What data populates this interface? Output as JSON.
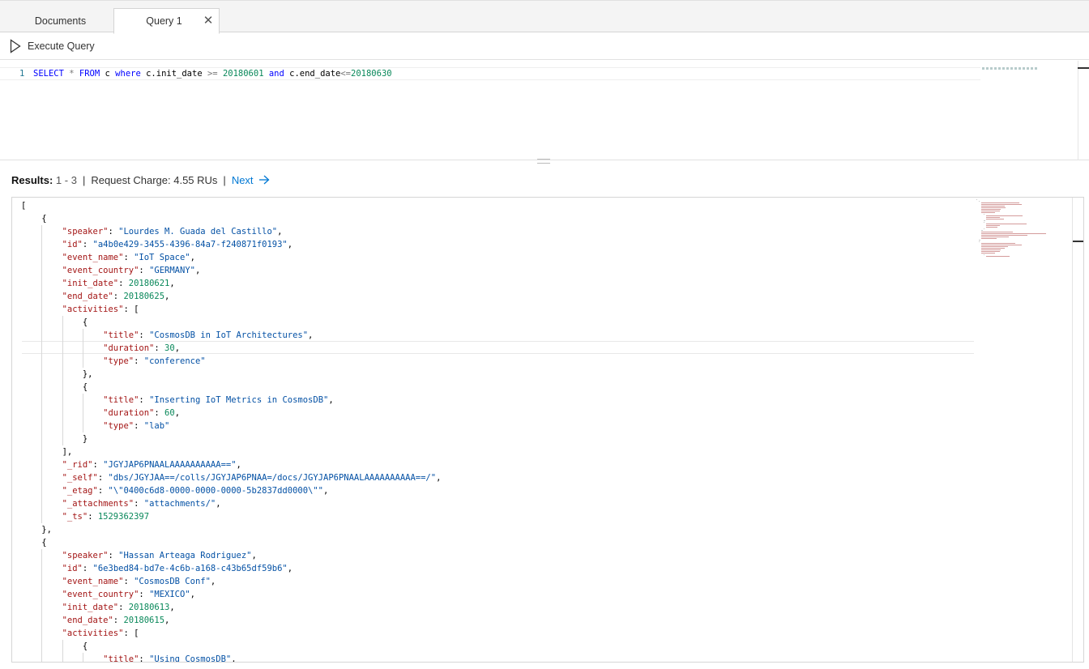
{
  "tabs": [
    {
      "label": "Documents"
    },
    {
      "label": "Query 1"
    }
  ],
  "toolbar": {
    "execute_label": "Execute Query"
  },
  "editor": {
    "line_number": "1",
    "tokens": [
      {
        "t": "SELECT",
        "c": "kw"
      },
      {
        "t": " * ",
        "c": "op"
      },
      {
        "t": "FROM",
        "c": "kw"
      },
      {
        "t": " c ",
        "c": "id"
      },
      {
        "t": "where",
        "c": "kw"
      },
      {
        "t": " c.init_date ",
        "c": "id"
      },
      {
        "t": ">=",
        "c": "op"
      },
      {
        "t": " 20180601 ",
        "c": "num"
      },
      {
        "t": "and",
        "c": "kw"
      },
      {
        "t": " c.end_date",
        "c": "id"
      },
      {
        "t": "<=",
        "c": "op"
      },
      {
        "t": "20180630",
        "c": "num"
      }
    ]
  },
  "results": {
    "label": "Results:",
    "range": "1 - 3",
    "charge": "Request Charge: 4.55 RUs",
    "next_label": "Next"
  },
  "json_lines": [
    [
      0,
      [
        [
          "[",
          "p"
        ]
      ]
    ],
    [
      1,
      [
        [
          "{",
          "p"
        ]
      ]
    ],
    [
      2,
      [
        [
          "\"speaker\"",
          "k"
        ],
        [
          ": ",
          "p"
        ],
        [
          "\"Lourdes M. Guada del Castillo\"",
          "s"
        ],
        [
          ",",
          "p"
        ]
      ]
    ],
    [
      2,
      [
        [
          "\"id\"",
          "k"
        ],
        [
          ": ",
          "p"
        ],
        [
          "\"a4b0e429-3455-4396-84a7-f240871f0193\"",
          "s"
        ],
        [
          ",",
          "p"
        ]
      ]
    ],
    [
      2,
      [
        [
          "\"event_name\"",
          "k"
        ],
        [
          ": ",
          "p"
        ],
        [
          "\"IoT Space\"",
          "s"
        ],
        [
          ",",
          "p"
        ]
      ]
    ],
    [
      2,
      [
        [
          "\"event_country\"",
          "k"
        ],
        [
          ": ",
          "p"
        ],
        [
          "\"GERMANY\"",
          "s"
        ],
        [
          ",",
          "p"
        ]
      ]
    ],
    [
      2,
      [
        [
          "\"init_date\"",
          "k"
        ],
        [
          ": ",
          "p"
        ],
        [
          "20180621",
          "n"
        ],
        [
          ",",
          "p"
        ]
      ]
    ],
    [
      2,
      [
        [
          "\"end_date\"",
          "k"
        ],
        [
          ": ",
          "p"
        ],
        [
          "20180625",
          "n"
        ],
        [
          ",",
          "p"
        ]
      ]
    ],
    [
      2,
      [
        [
          "\"activities\"",
          "k"
        ],
        [
          ": [",
          "p"
        ]
      ]
    ],
    [
      3,
      [
        [
          "{",
          "p"
        ]
      ]
    ],
    [
      4,
      [
        [
          "\"title\"",
          "k"
        ],
        [
          ": ",
          "p"
        ],
        [
          "\"CosmosDB in IoT Architectures\"",
          "s"
        ],
        [
          ",",
          "p"
        ]
      ]
    ],
    [
      4,
      [
        [
          "\"duration\"",
          "k"
        ],
        [
          ": ",
          "p"
        ],
        [
          "30",
          "n"
        ],
        [
          ",",
          "p"
        ]
      ]
    ],
    [
      4,
      [
        [
          "\"type\"",
          "k"
        ],
        [
          ": ",
          "p"
        ],
        [
          "\"conference\"",
          "s"
        ]
      ]
    ],
    [
      3,
      [
        [
          "},",
          "p"
        ]
      ]
    ],
    [
      3,
      [
        [
          "{",
          "p"
        ]
      ]
    ],
    [
      4,
      [
        [
          "\"title\"",
          "k"
        ],
        [
          ": ",
          "p"
        ],
        [
          "\"Inserting IoT Metrics in CosmosDB\"",
          "s"
        ],
        [
          ",",
          "p"
        ]
      ]
    ],
    [
      4,
      [
        [
          "\"duration\"",
          "k"
        ],
        [
          ": ",
          "p"
        ],
        [
          "60",
          "n"
        ],
        [
          ",",
          "p"
        ]
      ]
    ],
    [
      4,
      [
        [
          "\"type\"",
          "k"
        ],
        [
          ": ",
          "p"
        ],
        [
          "\"lab\"",
          "s"
        ]
      ]
    ],
    [
      3,
      [
        [
          "}",
          "p"
        ]
      ]
    ],
    [
      2,
      [
        [
          "],",
          "p"
        ]
      ]
    ],
    [
      2,
      [
        [
          "\"_rid\"",
          "k"
        ],
        [
          ": ",
          "p"
        ],
        [
          "\"JGYJAP6PNAALAAAAAAAAAA==\"",
          "s"
        ],
        [
          ",",
          "p"
        ]
      ]
    ],
    [
      2,
      [
        [
          "\"_self\"",
          "k"
        ],
        [
          ": ",
          "p"
        ],
        [
          "\"dbs/JGYJAA==/colls/JGYJAP6PNAA=/docs/JGYJAP6PNAALAAAAAAAAAA==/\"",
          "s"
        ],
        [
          ",",
          "p"
        ]
      ]
    ],
    [
      2,
      [
        [
          "\"_etag\"",
          "k"
        ],
        [
          ": ",
          "p"
        ],
        [
          "\"\\\"0400c6d8-0000-0000-0000-5b2837dd0000\\\"\"",
          "s"
        ],
        [
          ",",
          "p"
        ]
      ]
    ],
    [
      2,
      [
        [
          "\"_attachments\"",
          "k"
        ],
        [
          ": ",
          "p"
        ],
        [
          "\"attachments/\"",
          "s"
        ],
        [
          ",",
          "p"
        ]
      ]
    ],
    [
      2,
      [
        [
          "\"_ts\"",
          "k"
        ],
        [
          ": ",
          "p"
        ],
        [
          "1529362397",
          "n"
        ]
      ]
    ],
    [
      1,
      [
        [
          "},",
          "p"
        ]
      ]
    ],
    [
      1,
      [
        [
          "{",
          "p"
        ]
      ]
    ],
    [
      2,
      [
        [
          "\"speaker\"",
          "k"
        ],
        [
          ": ",
          "p"
        ],
        [
          "\"Hassan Arteaga Rodriguez\"",
          "s"
        ],
        [
          ",",
          "p"
        ]
      ]
    ],
    [
      2,
      [
        [
          "\"id\"",
          "k"
        ],
        [
          ": ",
          "p"
        ],
        [
          "\"6e3bed84-bd7e-4c6b-a168-c43b65df59b6\"",
          "s"
        ],
        [
          ",",
          "p"
        ]
      ]
    ],
    [
      2,
      [
        [
          "\"event_name\"",
          "k"
        ],
        [
          ": ",
          "p"
        ],
        [
          "\"CosmosDB Conf\"",
          "s"
        ],
        [
          ",",
          "p"
        ]
      ]
    ],
    [
      2,
      [
        [
          "\"event_country\"",
          "k"
        ],
        [
          ": ",
          "p"
        ],
        [
          "\"MEXICO\"",
          "s"
        ],
        [
          ",",
          "p"
        ]
      ]
    ],
    [
      2,
      [
        [
          "\"init_date\"",
          "k"
        ],
        [
          ": ",
          "p"
        ],
        [
          "20180613",
          "n"
        ],
        [
          ",",
          "p"
        ]
      ]
    ],
    [
      2,
      [
        [
          "\"end_date\"",
          "k"
        ],
        [
          ": ",
          "p"
        ],
        [
          "20180615",
          "n"
        ],
        [
          ",",
          "p"
        ]
      ]
    ],
    [
      2,
      [
        [
          "\"activities\"",
          "k"
        ],
        [
          ": [",
          "p"
        ]
      ]
    ],
    [
      3,
      [
        [
          "{",
          "p"
        ]
      ]
    ],
    [
      4,
      [
        [
          "\"title\"",
          "k"
        ],
        [
          ": ",
          "p"
        ],
        [
          "\"Using CosmosDB\"",
          "s"
        ],
        [
          ",",
          "p"
        ]
      ]
    ]
  ],
  "icons": {
    "execute": "play-icon",
    "close": "close-icon",
    "next": "arrow-right-icon"
  }
}
